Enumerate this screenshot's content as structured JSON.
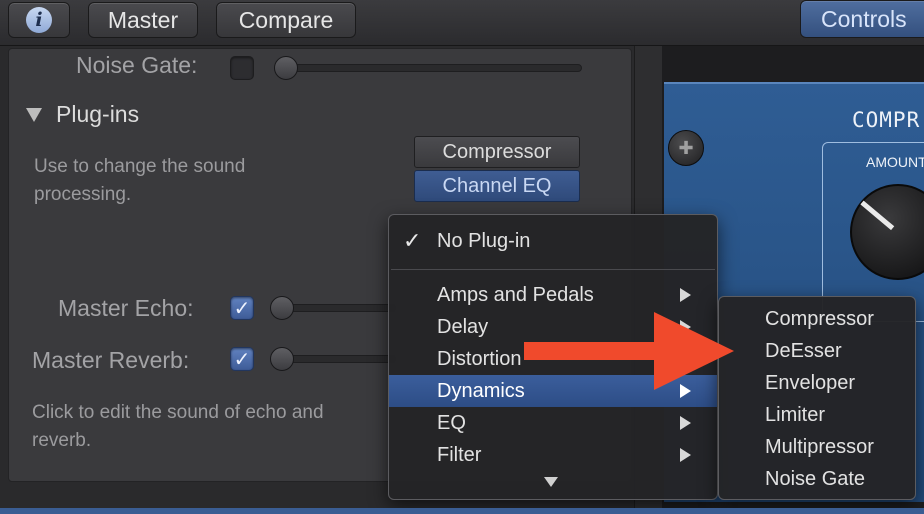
{
  "toolbar": {
    "info_label": "i",
    "master_label": "Master",
    "compare_label": "Compare",
    "controls_label": "Controls"
  },
  "left": {
    "noise_gate_label": "Noise Gate:",
    "plugins_heading": "Plug-ins",
    "plugins_desc": "Use to change the sound processing.",
    "master_echo_label": "Master Echo:",
    "master_reverb_label": "Master Reverb:",
    "echo_desc": "Click to edit the sound of echo and reverb.",
    "checkmark": "✓"
  },
  "slots": [
    {
      "label": "Compressor"
    },
    {
      "label": "Channel EQ"
    }
  ],
  "plugin_face": {
    "title": "COMPR",
    "amount_label": "AMOUNT",
    "screw_glyph": "✚"
  },
  "menu": {
    "check_glyph": "✓",
    "items": [
      {
        "label": "No Plug-in",
        "checked": true
      },
      {
        "label": "Amps and Pedals",
        "submenu": true
      },
      {
        "label": "Delay",
        "submenu": true
      },
      {
        "label": "Distortion",
        "submenu": true
      },
      {
        "label": "Dynamics",
        "submenu": true,
        "selected": true
      },
      {
        "label": "EQ",
        "submenu": true
      },
      {
        "label": "Filter",
        "submenu": true
      }
    ]
  },
  "submenu": {
    "items": [
      {
        "label": "Compressor"
      },
      {
        "label": "DeEsser"
      },
      {
        "label": "Enveloper"
      },
      {
        "label": "Limiter"
      },
      {
        "label": "Multipressor"
      },
      {
        "label": "Noise Gate"
      }
    ]
  },
  "colors": {
    "accent_blue": "#3b5e9c",
    "annotation_arrow": "#f04a2c",
    "plugin_blue": "#2f5d94"
  },
  "icons": {
    "info": "info-icon",
    "disclosure": "triangle-down-icon",
    "submenu_arrow": "chevron-right-icon",
    "scroll_down": "scroll-down-icon",
    "screw": "screw-icon",
    "annotation": "red-arrow-icon"
  }
}
